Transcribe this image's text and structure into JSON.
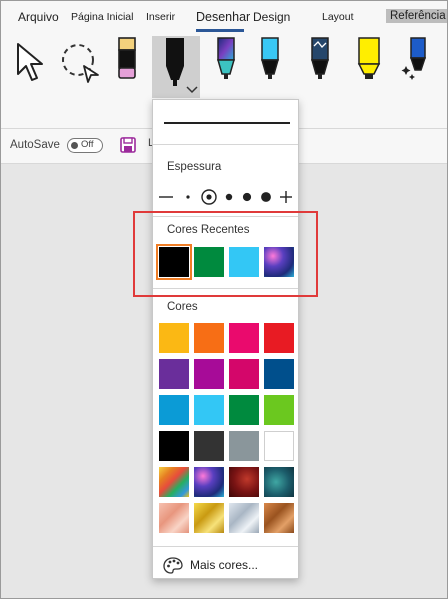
{
  "tabs": [
    {
      "label": "Arquivo"
    },
    {
      "label": "Página Inicial"
    },
    {
      "label": "Inserir"
    },
    {
      "label": "Desenhar"
    },
    {
      "label": "Design"
    },
    {
      "label": "Layout"
    },
    {
      "label": "Referência"
    }
  ],
  "active_tab": "Desenhar",
  "tools": [
    {
      "name": "select-tool",
      "icon": "cursor-arrow-icon"
    },
    {
      "name": "lasso-select-tool",
      "icon": "lasso-icon"
    },
    {
      "name": "eraser-tool",
      "icon": "eraser-icon",
      "color": "#e5a0d8"
    },
    {
      "name": "pen-black",
      "icon": "pen-icon",
      "color": "#111111",
      "selected": true
    },
    {
      "name": "pen-galaxy",
      "icon": "pen-icon",
      "color": "#5b3fa8"
    },
    {
      "name": "pen-light-blue",
      "icon": "pen-icon",
      "color": "#39c8f4"
    },
    {
      "name": "pen-sparkle",
      "icon": "pen-icon",
      "color": "#26476b"
    },
    {
      "name": "highlighter-yellow",
      "icon": "highlighter-icon",
      "color": "#ffee00"
    },
    {
      "name": "action-pen",
      "icon": "sparkle-pen-icon",
      "color": "#1d5cc9"
    }
  ],
  "bar": {
    "autosave_label": "AutoSave",
    "toggle_label": "Off",
    "partial_letter": "L"
  },
  "dropdown": {
    "thickness_title": "Espessura",
    "thickness_levels": [
      "minus",
      "1",
      "2",
      "3",
      "4",
      "5",
      "plus"
    ],
    "selected_thickness": "2",
    "recent_title": "Cores Recentes",
    "recent_colors": [
      "#000000",
      "#008a3e",
      "#33c7f5",
      "galaxy"
    ],
    "colors_title": "Cores",
    "colors": [
      [
        "#fbb814",
        "#f76e15",
        "#ea0a6d",
        "#e81b23"
      ],
      [
        "#6a2e9b",
        "#a70b98",
        "#d4066a",
        "#004f8c"
      ],
      [
        "#0b9bd6",
        "#33c7f5",
        "#008a3e",
        "#6bc81f"
      ],
      [
        "#000000",
        "#333333",
        "#8a969b",
        "#ffffff"
      ],
      [
        "rainbow",
        "galaxy",
        "ruby",
        "ocean"
      ],
      [
        "rose-gold",
        "gold",
        "silver",
        "bronze"
      ]
    ],
    "more_colors_label": "Mais cores..."
  }
}
